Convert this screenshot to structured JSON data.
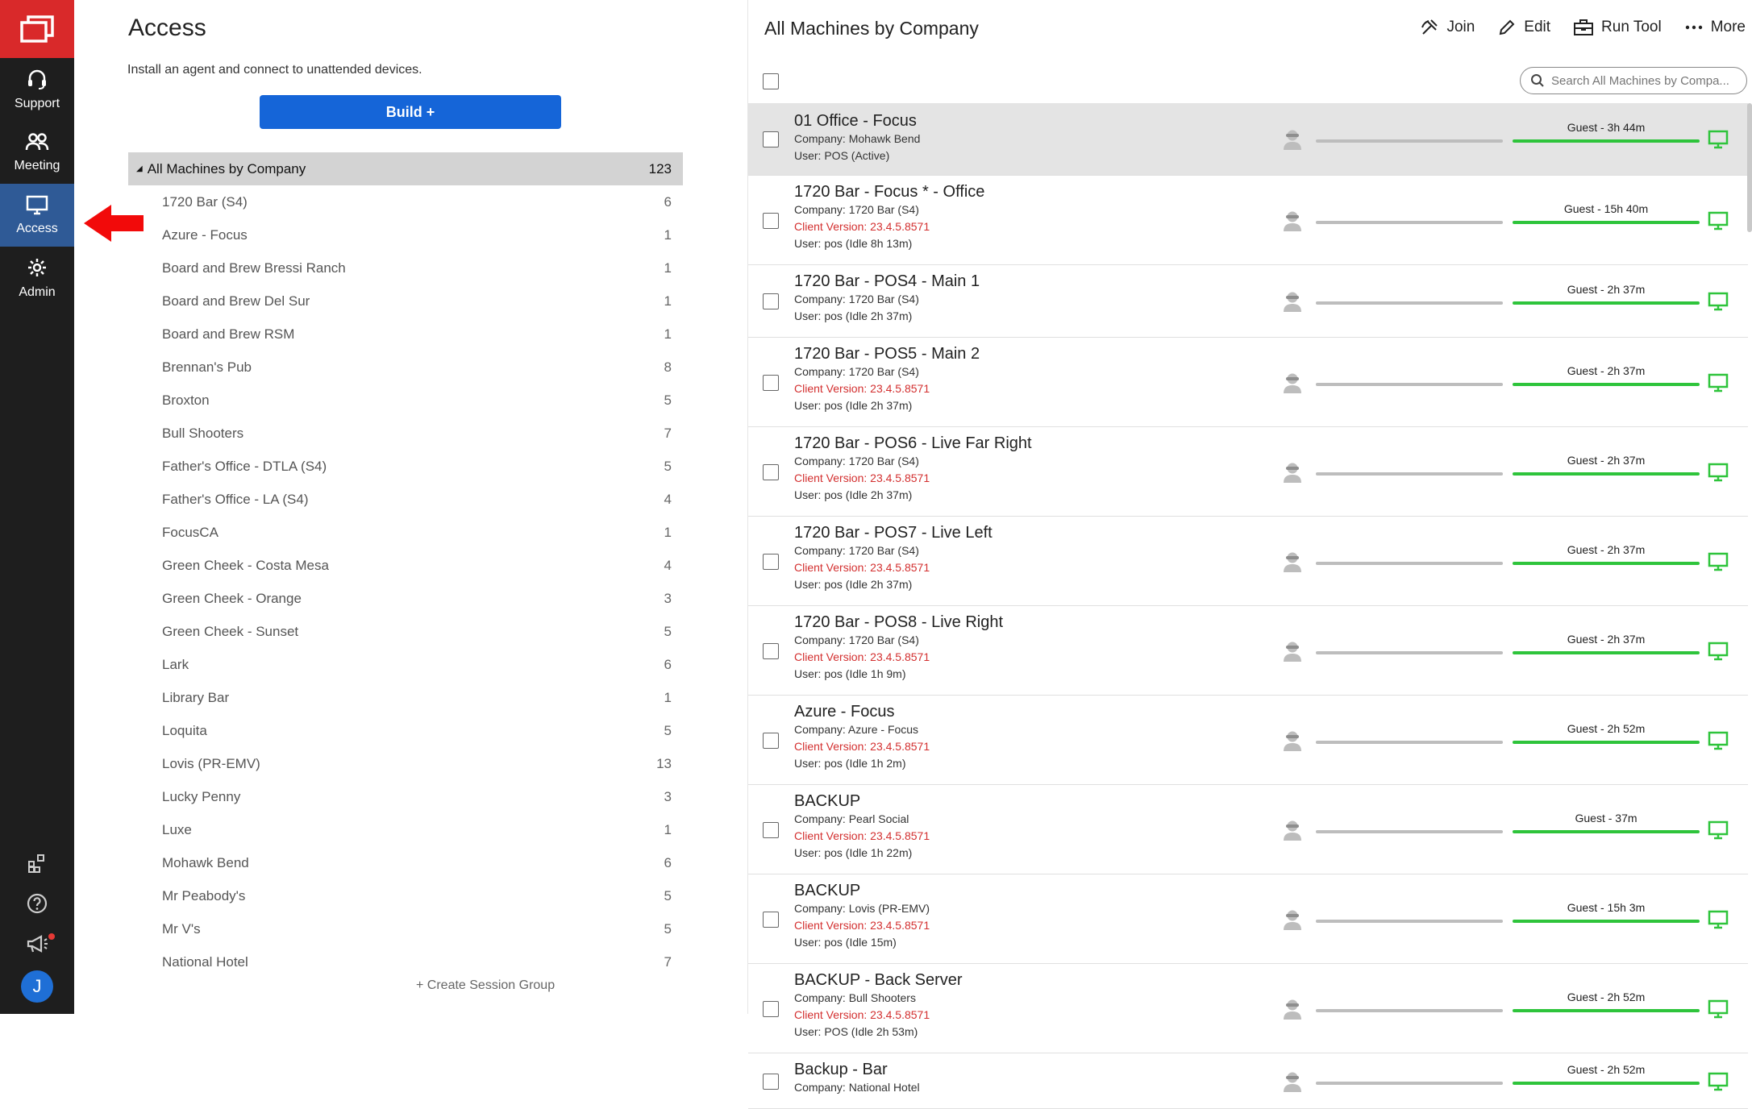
{
  "rail": {
    "items": [
      {
        "label": "Support",
        "icon": "headset-icon"
      },
      {
        "label": "Meeting",
        "icon": "people-icon"
      },
      {
        "label": "Access",
        "icon": "monitor-icon",
        "active": true
      },
      {
        "label": "Admin",
        "icon": "gear-icon"
      }
    ],
    "avatar_initial": "J"
  },
  "access": {
    "title": "Access",
    "subtitle": "Install an agent and connect to unattended devices.",
    "build_label": "Build +",
    "all_group": {
      "name": "All Machines by Company",
      "count": "123"
    },
    "groups": [
      {
        "name": "1720 Bar (S4)",
        "count": "6"
      },
      {
        "name": "Azure - Focus",
        "count": "1"
      },
      {
        "name": "Board and Brew Bressi Ranch",
        "count": "1"
      },
      {
        "name": "Board and Brew Del Sur",
        "count": "1"
      },
      {
        "name": "Board and Brew RSM",
        "count": "1"
      },
      {
        "name": "Brennan's Pub",
        "count": "8"
      },
      {
        "name": "Broxton",
        "count": "5"
      },
      {
        "name": "Bull Shooters",
        "count": "7"
      },
      {
        "name": "Father's Office - DTLA (S4)",
        "count": "5"
      },
      {
        "name": "Father's Office - LA (S4)",
        "count": "4"
      },
      {
        "name": "FocusCA",
        "count": "1"
      },
      {
        "name": "Green Cheek - Costa Mesa",
        "count": "4"
      },
      {
        "name": "Green Cheek - Orange",
        "count": "3"
      },
      {
        "name": "Green Cheek - Sunset",
        "count": "5"
      },
      {
        "name": "Lark",
        "count": "6"
      },
      {
        "name": "Library Bar",
        "count": "1"
      },
      {
        "name": "Loquita",
        "count": "5"
      },
      {
        "name": "Lovis (PR-EMV)",
        "count": "13"
      },
      {
        "name": "Lucky Penny",
        "count": "3"
      },
      {
        "name": "Luxe",
        "count": "1"
      },
      {
        "name": "Mohawk Bend",
        "count": "6"
      },
      {
        "name": "Mr Peabody's",
        "count": "5"
      },
      {
        "name": "Mr V's",
        "count": "5"
      },
      {
        "name": "National Hotel",
        "count": "7"
      }
    ],
    "create_group_label": "+ Create Session Group"
  },
  "machines": {
    "title": "All Machines by Company",
    "actions": [
      {
        "label": "Join",
        "icon": "join-icon"
      },
      {
        "label": "Edit",
        "icon": "pencil-icon"
      },
      {
        "label": "Run Tool",
        "icon": "toolbox-icon"
      },
      {
        "label": "More",
        "icon": "more-dots-icon"
      }
    ],
    "search_placeholder": "Search All Machines by Compa...",
    "colors": {
      "guest_bar": "#2ec43b",
      "host_bar": "#bdbdbd",
      "monitor": "#2ec43b",
      "client_version": "#d32f2f"
    },
    "rows": [
      {
        "name": "01 Office - Focus",
        "company": "Company: Mohawk Bend",
        "version": "",
        "user": "User: POS (Active)",
        "guest": "Guest - 3h 44m",
        "selected": true
      },
      {
        "name": "1720 Bar - Focus * - Office",
        "company": "Company: 1720 Bar (S4)",
        "version": "Client Version: 23.4.5.8571",
        "user": "User: pos (Idle 8h 13m)",
        "guest": "Guest - 15h 40m"
      },
      {
        "name": "1720 Bar - POS4 - Main 1",
        "company": "Company: 1720 Bar (S4)",
        "version": "",
        "user": "User: pos (Idle 2h 37m)",
        "guest": "Guest - 2h 37m"
      },
      {
        "name": "1720 Bar - POS5 - Main 2",
        "company": "Company: 1720 Bar (S4)",
        "version": "Client Version: 23.4.5.8571",
        "user": "User: pos (Idle 2h 37m)",
        "guest": "Guest - 2h 37m"
      },
      {
        "name": "1720 Bar - POS6 - Live Far Right",
        "company": "Company: 1720 Bar (S4)",
        "version": "Client Version: 23.4.5.8571",
        "user": "User: pos (Idle 2h 37m)",
        "guest": "Guest - 2h 37m"
      },
      {
        "name": "1720 Bar - POS7 - Live Left",
        "company": "Company: 1720 Bar (S4)",
        "version": "Client Version: 23.4.5.8571",
        "user": "User: pos (Idle 2h 37m)",
        "guest": "Guest - 2h 37m"
      },
      {
        "name": "1720 Bar - POS8 - Live Right",
        "company": "Company: 1720 Bar (S4)",
        "version": "Client Version: 23.4.5.8571",
        "user": "User: pos (Idle 1h 9m)",
        "guest": "Guest - 2h 37m"
      },
      {
        "name": "Azure - Focus",
        "company": "Company: Azure - Focus",
        "version": "Client Version: 23.4.5.8571",
        "user": "User: pos (Idle 1h 2m)",
        "guest": "Guest - 2h 52m"
      },
      {
        "name": "BACKUP",
        "company": "Company: Pearl Social",
        "version": "Client Version: 23.4.5.8571",
        "user": "User: pos (Idle 1h 22m)",
        "guest": "Guest - 37m"
      },
      {
        "name": "BACKUP",
        "company": "Company: Lovis (PR-EMV)",
        "version": "Client Version: 23.4.5.8571",
        "user": "User: pos (Idle 15m)",
        "guest": "Guest - 15h 3m"
      },
      {
        "name": "BACKUP - Back Server",
        "company": "Company: Bull Shooters",
        "version": "Client Version: 23.4.5.8571",
        "user": "User: POS (Idle 2h 53m)",
        "guest": "Guest - 2h 52m"
      },
      {
        "name": "Backup - Bar",
        "company": "Company: National Hotel",
        "version": "",
        "user": "",
        "guest": "Guest - 2h 52m"
      }
    ]
  }
}
